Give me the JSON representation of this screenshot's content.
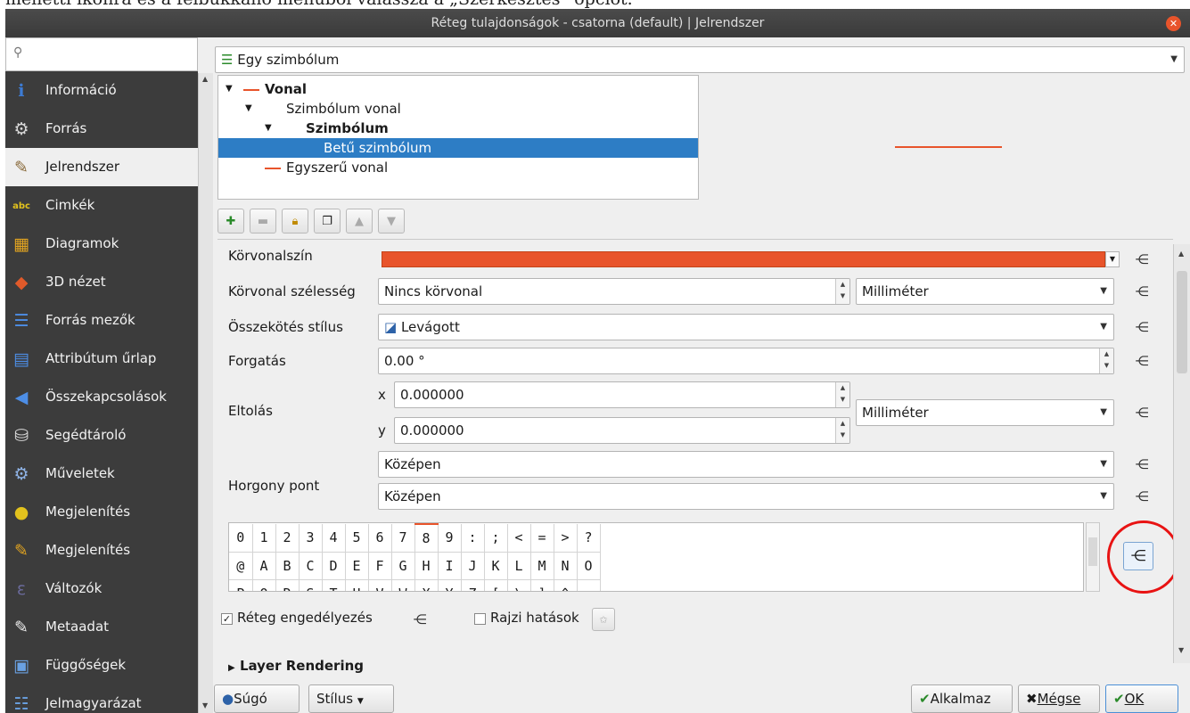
{
  "doc_text": "melletti ikonra és a felbukkanó menüből válassza a „Szerkesztés” opciót.",
  "window": {
    "title": "Réteg tulajdonságok - csatorna (default) | Jelrendszer"
  },
  "sidebar": {
    "search_placeholder": "",
    "items": [
      {
        "label": "Információ",
        "icon": "info-icon",
        "active": false
      },
      {
        "label": "Forrás",
        "icon": "source-icon",
        "active": false
      },
      {
        "label": "Jelrendszer",
        "icon": "symbology-icon",
        "active": true
      },
      {
        "label": "Cimkék",
        "icon": "labels-icon",
        "active": false
      },
      {
        "label": "Diagramok",
        "icon": "diagrams-icon",
        "active": false
      },
      {
        "label": "3D nézet",
        "icon": "3d-view-icon",
        "active": false
      },
      {
        "label": "Forrás mezők",
        "icon": "fields-icon",
        "active": false
      },
      {
        "label": "Attribútum űrlap",
        "icon": "attribute-form-icon",
        "active": false
      },
      {
        "label": "Összekapcsolások",
        "icon": "joins-icon",
        "active": false
      },
      {
        "label": "Segédtároló",
        "icon": "auxiliary-storage-icon",
        "active": false
      },
      {
        "label": "Műveletek",
        "icon": "actions-icon",
        "active": false
      },
      {
        "label": "Megjelenítés",
        "icon": "display-icon",
        "active": false
      },
      {
        "label": "Megjelenítés",
        "icon": "rendering-icon",
        "active": false
      },
      {
        "label": "Változók",
        "icon": "variables-icon",
        "active": false
      },
      {
        "label": "Metaadat",
        "icon": "metadata-icon",
        "active": false
      },
      {
        "label": "Függőségek",
        "icon": "dependencies-icon",
        "active": false
      },
      {
        "label": "Jelmagyarázat",
        "icon": "legend-icon",
        "active": false
      }
    ]
  },
  "renderer": {
    "value": "Egy szimbólum"
  },
  "tree": {
    "rows": [
      {
        "label": "Vonal",
        "bold": true,
        "expanded": true
      },
      {
        "label": "Szimbólum vonal",
        "bold": false,
        "expanded": true
      },
      {
        "label": "Szimbólum",
        "bold": true,
        "expanded": true
      },
      {
        "label": "Betű szimbólum",
        "bold": false,
        "selected": true
      },
      {
        "label": "Egyszerű vonal",
        "bold": false
      }
    ]
  },
  "props": {
    "stroke_color_label": "Körvonalszín",
    "stroke_color": "#e8542b",
    "stroke_width_label": "Körvonal szélesség",
    "stroke_width_value": "Nincs körvonal",
    "stroke_width_unit": "Milliméter",
    "join_style_label": "Összekötés stílus",
    "join_style_value": "Levágott",
    "rotation_label": "Forgatás",
    "rotation_value": "0.00 °",
    "offset_label": "Eltolás",
    "offset_x_label": "x",
    "offset_x_value": "0.000000",
    "offset_y_label": "y",
    "offset_y_value": "0.000000",
    "offset_unit": "Milliméter",
    "anchor_label": "Horgony pont",
    "anchor_h": "Középen",
    "anchor_v": "Középen"
  },
  "charmap": {
    "rows": [
      [
        "0",
        "1",
        "2",
        "3",
        "4",
        "5",
        "6",
        "7",
        "8",
        "9",
        ":",
        ";",
        "<",
        "=",
        ">",
        "?"
      ],
      [
        "@",
        "A",
        "B",
        "C",
        "D",
        "E",
        "F",
        "G",
        "H",
        "I",
        "J",
        "K",
        "L",
        "M",
        "N",
        "O"
      ],
      [
        "P",
        "Q",
        "R",
        "S",
        "T",
        "U",
        "V",
        "W",
        "X",
        "Y",
        "Z",
        "[",
        "\\",
        "]",
        "^",
        ""
      ]
    ],
    "current_index": 8
  },
  "layer_options": {
    "enable_label": "Réteg engedélyezés",
    "enable_checked": true,
    "draw_effects_label": "Rajzi hatások",
    "draw_effects_checked": false,
    "section_label": "Layer Rendering"
  },
  "buttons": {
    "help": "Súgó",
    "style": "Stílus",
    "apply": "Alkalmaz",
    "cancel": "Mégse",
    "ok": "OK"
  }
}
